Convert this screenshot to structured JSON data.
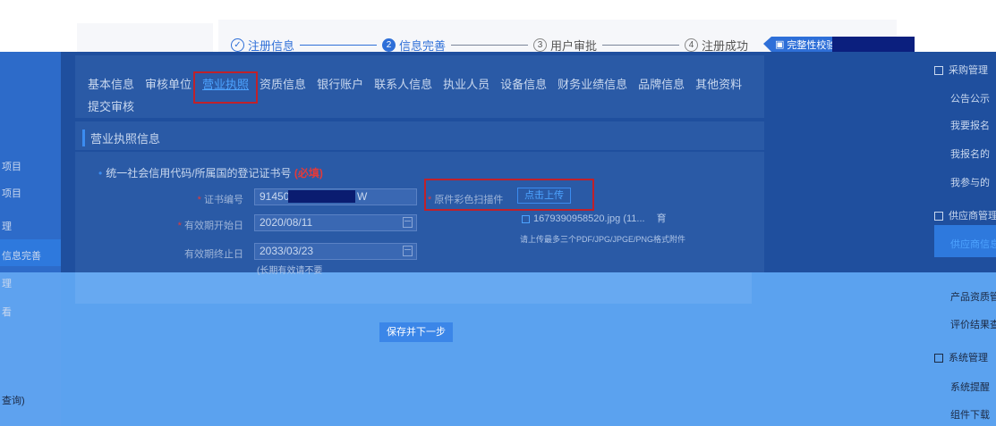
{
  "steps": [
    {
      "num": "✓",
      "label": "注册信息"
    },
    {
      "num": "2",
      "label": "信息完善"
    },
    {
      "num": "3",
      "label": "用户审批"
    },
    {
      "num": "4",
      "label": "注册成功"
    }
  ],
  "complete_button": "完整性校验",
  "tabs": [
    "基本信息",
    "审核单位",
    "营业执照",
    "资质信息",
    "银行账户",
    "联系人信息",
    "执业人员",
    "设备信息",
    "财务业绩信息",
    "品牌信息",
    "其他资料"
  ],
  "tab_row2": "提交审核",
  "section_title": "营业执照信息",
  "field_group": {
    "title": "统一社会信用代码/所属国的登记证书号",
    "required": "(必填)"
  },
  "form": {
    "cert_no_label": "证书编号",
    "cert_no_prefix": "91450",
    "cert_no_suffix": "W",
    "start_label": "有效期开始日",
    "start_value": "2020/08/11",
    "end_label": "有效期终止日",
    "end_value": "2033/03/23",
    "long_term_note": "(长期有效请不要",
    "scan_label": "原件彩色扫描件",
    "upload_label": "点击上传",
    "file_name": "1679390958520.jpg (11...",
    "file_action": "育",
    "hint": "请上传最多三个PDF/JPG/JPGE/PNG格式附件"
  },
  "save_button": "保存并下一步",
  "left_rail": [
    "项目",
    "项目",
    "理",
    "信息完善",
    "理",
    "看",
    "查询)"
  ],
  "right_rail": {
    "group1": "采购管理",
    "items1": [
      "公告公示",
      "我要报名",
      "我报名的",
      "我参与的"
    ],
    "group2": "供应商管理",
    "active": "供应商信息",
    "items2": [
      "产品资质管理",
      "评价结果查询"
    ],
    "group3": "系统管理",
    "items3": [
      "系统提醒",
      "组件下载（"
    ]
  },
  "colors": {
    "band": "#1f4f9e",
    "lower": "#5ba2ef",
    "accent": "#2e6fd8",
    "highlight": "#c0212a"
  }
}
